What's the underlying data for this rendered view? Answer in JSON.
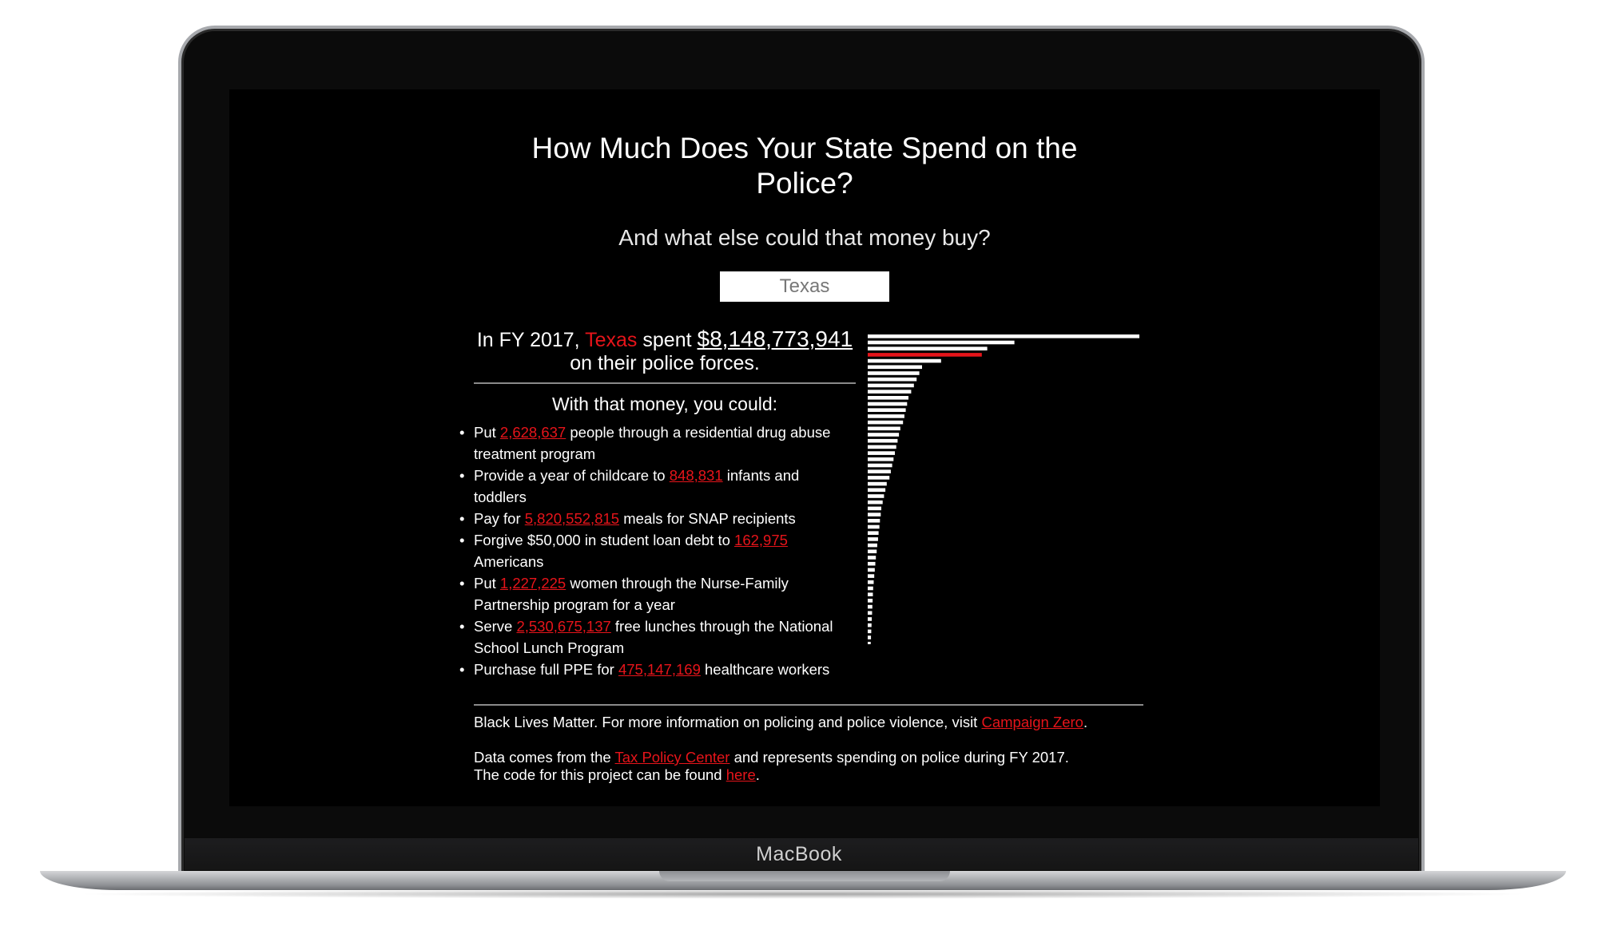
{
  "device": {
    "brand": "MacBook"
  },
  "page": {
    "title": "How Much Does Your State Spend on the Police?",
    "subtitle": "And what else could that money buy?",
    "state_select": {
      "value": "Texas"
    },
    "spent": {
      "prefix": "In FY 2017,",
      "state": "Texas",
      "verb": "spent",
      "amount": "$8,148,773,941",
      "suffix": "on their police forces."
    },
    "with_money": "With that money, you could:",
    "items": [
      {
        "pre": "Put",
        "value": "2,628,637",
        "post": "people through a residential drug abuse treatment program"
      },
      {
        "pre": "Provide a year of childcare to",
        "value": "848,831",
        "post": "infants and toddlers"
      },
      {
        "pre": "Pay for",
        "value": "5,820,552,815",
        "post": "meals for SNAP recipients"
      },
      {
        "pre": "Forgive $50,000 in student loan debt to",
        "value": "162,975",
        "post": "Americans"
      },
      {
        "pre": "Put",
        "value": "1,227,225",
        "post": "women through the Nurse-Family Partnership program for a year"
      },
      {
        "pre": "Serve",
        "value": "2,530,675,137",
        "post": "free lunches through the National School Lunch Program"
      },
      {
        "pre": "Purchase full PPE for",
        "value": "475,147,169",
        "post": "healthcare workers"
      }
    ],
    "footer": {
      "line1_pre": "Black Lives Matter. For more information on policing and police violence, visit",
      "line1_link": "Campaign Zero",
      "line1_post": ".",
      "line2_pre": "Data comes from the",
      "line2_link": "Tax Policy Center",
      "line2_post": "and represents spending on police during FY 2017.",
      "line3_pre": "The code for this project can be found",
      "line3_link": "here",
      "line3_post": "."
    }
  },
  "colors": {
    "accent": "#e6141a",
    "bar": "#ffffff",
    "background": "#000000"
  },
  "chart_data": {
    "type": "bar",
    "orientation": "horizontal",
    "highlight_index": 3,
    "values": [
      100,
      54,
      44,
      42,
      27,
      20,
      19,
      18,
      17,
      16,
      15,
      14.5,
      14,
      13.5,
      13,
      12,
      11.5,
      11,
      10.5,
      10,
      9.5,
      9,
      8.5,
      8,
      7,
      6.5,
      6,
      5.5,
      5,
      4.8,
      4.5,
      4.3,
      4,
      3.8,
      3.5,
      3.3,
      3,
      2.8,
      2.6,
      2.4,
      2.2,
      2,
      1.9,
      1.8,
      1.7,
      1.6,
      1.5,
      1.4,
      1.3,
      1.2,
      1.1
    ]
  }
}
